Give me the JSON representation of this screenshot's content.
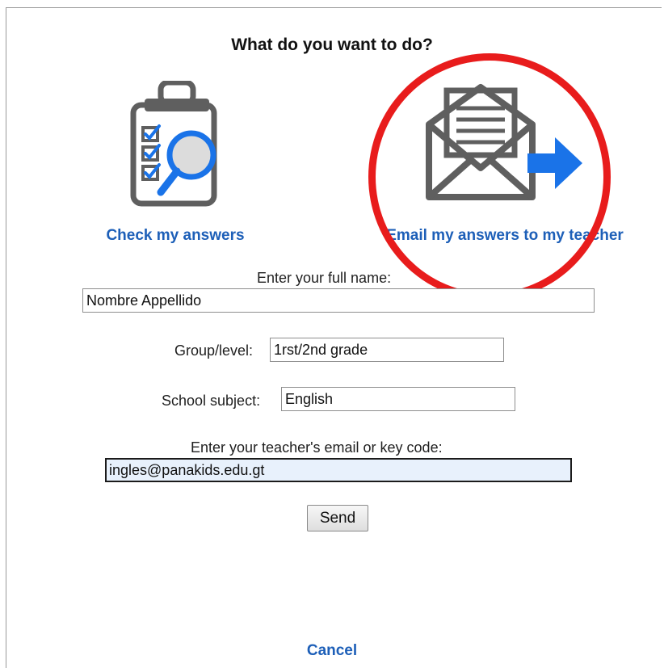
{
  "dialog": {
    "title": "What do you want to do?",
    "options": [
      {
        "label": "Check my answers",
        "icon": "clipboard-magnifier-icon"
      },
      {
        "label": "Email my answers to my teacher",
        "icon": "envelope-arrow-icon"
      }
    ]
  },
  "form": {
    "full_name": {
      "label": "Enter your full name:",
      "value": "Nombre Appellido"
    },
    "group_level": {
      "label": "Group/level:",
      "value": "1rst/2nd grade"
    },
    "school_subject": {
      "label": "School subject:",
      "value": "English"
    },
    "teacher_email": {
      "label": "Enter your teacher's email or key code:",
      "value": "ingles@panakids.edu.gt"
    },
    "send_label": "Send"
  },
  "cancel_label": "Cancel",
  "colors": {
    "link": "#1d5fb8",
    "accent_blue": "#1a73e8",
    "icon_gray": "#5f5f5f",
    "highlight_circle": "#e81c1c"
  }
}
